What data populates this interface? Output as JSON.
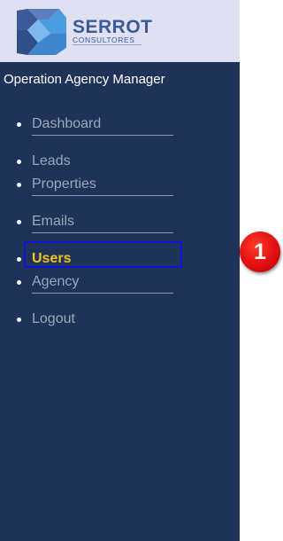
{
  "brand": {
    "name": "SERROT",
    "subtitle": "CONSULTORES",
    "logo_icon": "serrot-cube-logo-icon",
    "colors": {
      "sidebar_bg": "#1f3358",
      "logo_bg": "#dfe0f1",
      "active": "#f4c21d",
      "inactive": "#9aa7bd",
      "highlight": "#1010e0",
      "badge": "#e00f0f"
    }
  },
  "app_title": "Operation Agency Manager",
  "nav": {
    "items": [
      {
        "label": "Dashboard",
        "active": false
      },
      {
        "label": "Leads",
        "active": false
      },
      {
        "label": "Properties",
        "active": false
      },
      {
        "label": "Emails",
        "active": false
      },
      {
        "label": "Users",
        "active": true
      },
      {
        "label": "Agency",
        "active": false
      },
      {
        "label": "Logout",
        "active": false
      }
    ]
  },
  "annotation": {
    "step_number": "1"
  }
}
